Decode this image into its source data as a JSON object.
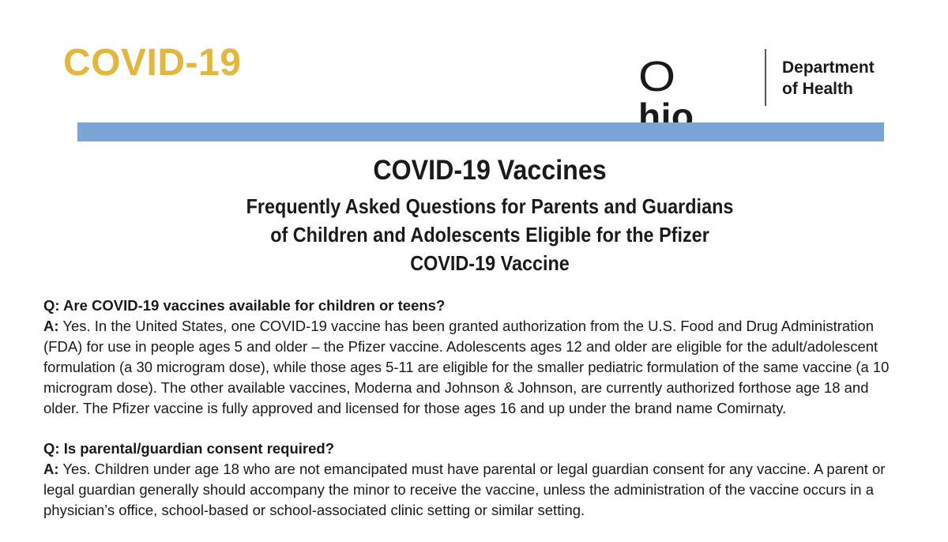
{
  "header": {
    "brand_text": "COVID-19",
    "logo": {
      "ohio_first_letter": "O",
      "ohio_rest": "hio",
      "dept_line1": "Department",
      "dept_line2": "of Health"
    },
    "colors": {
      "brand": "#e2b641",
      "rule_bar": "#7ba4d6"
    }
  },
  "title": "COVID-19 Vaccines",
  "subtitle_lines": [
    "Frequently Asked Questions for Parents and Guardians",
    "of Children and Adolescents Eligible for the Pfizer",
    "COVID-19 Vaccine"
  ],
  "faq": [
    {
      "question": "Q: Are COVID-19 vaccines available for children or teens?",
      "answer_label": "A:",
      "answer_lines": [
        " Yes. In the United States, one COVID-19 vaccine has been granted authorization from the U.S. Food and Drug Administration",
        "(FDA) for use in people ages 5 and older – the Pfizer vaccine. Adolescents ages 12 and older are eligible for the adult/adolescent",
        "formulation (a 30 microgram dose), while those ages 5-11 are eligible for the smaller pediatric formulation of the same vaccine (a 10",
        "microgram dose). The other available vaccines, Moderna and Johnson & Johnson, are currently authorized forthose age 18 and",
        "older. The Pfizer vaccine is fully approved and licensed for those ages 16 and up under the brand name Comirnaty."
      ]
    },
    {
      "question": "Q: Is parental/guardian consent required?",
      "answer_label": "A:",
      "answer_lines": [
        " Yes. Children under age 18 who are not emancipated must have parental or legal guardian consent for any vaccine. A parent or",
        "legal guardian generally should accompany the minor to receive the vaccine, unless the administration of the vaccine occurs in a",
        "physician’s office, school-based or school-associated clinic setting or similar setting."
      ]
    }
  ]
}
